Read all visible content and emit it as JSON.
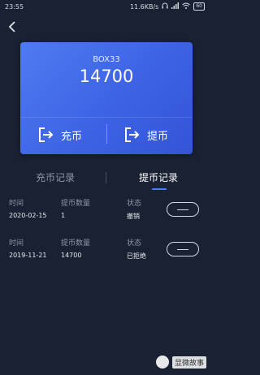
{
  "status_bar": {
    "time": "23:55",
    "speed": "11.6KB/s",
    "battery": "60"
  },
  "card": {
    "symbol": "BOX33",
    "balance": "14700",
    "deposit_label": "充币",
    "withdraw_label": "提币"
  },
  "tabs": [
    {
      "label": "充币记录",
      "active": false
    },
    {
      "label": "提币记录",
      "active": true
    }
  ],
  "records": [
    {
      "time_label": "时间",
      "qty_label": "提币数量",
      "status_label": "状态",
      "time": "2020-02-15",
      "qty": "1",
      "status": "撤销"
    },
    {
      "time_label": "时间",
      "qty_label": "提币数量",
      "status_label": "状态",
      "time": "2019-11-21",
      "qty": "14700",
      "status": "已拒绝"
    }
  ],
  "watermark": "显微故事",
  "colors": {
    "background": "#1a2132",
    "card": "#4369e8",
    "accent": "#4d7cf5"
  }
}
